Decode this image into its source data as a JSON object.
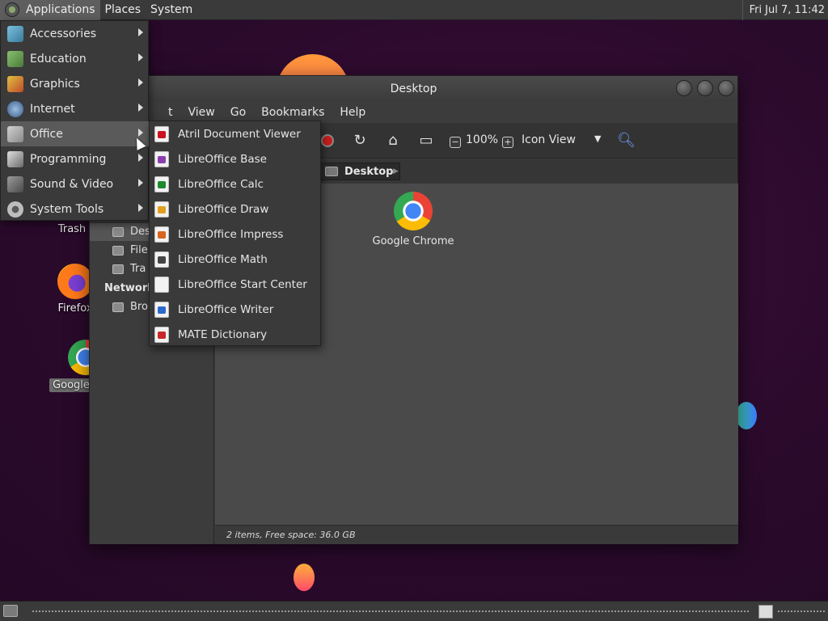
{
  "top_panel": {
    "menus": [
      "Applications",
      "Places",
      "System"
    ],
    "clock": "Fri Jul  7, 11:42"
  },
  "desktop_icons": {
    "trash": "Trash",
    "firefox": "Firefox",
    "chrome": "Google"
  },
  "apps_menu": {
    "items": [
      {
        "label": "Accessories",
        "icon": "accessories-icon"
      },
      {
        "label": "Education",
        "icon": "education-icon"
      },
      {
        "label": "Graphics",
        "icon": "graphics-icon"
      },
      {
        "label": "Internet",
        "icon": "internet-icon"
      },
      {
        "label": "Office",
        "icon": "office-icon"
      },
      {
        "label": "Programming",
        "icon": "programming-icon"
      },
      {
        "label": "Sound & Video",
        "icon": "sound-video-icon"
      },
      {
        "label": "System Tools",
        "icon": "system-tools-icon"
      }
    ],
    "active": "Office"
  },
  "office_submenu": {
    "items": [
      {
        "label": "Atril Document Viewer",
        "icon": "atril-icon"
      },
      {
        "label": "LibreOffice Base",
        "icon": "libreoffice-base-icon"
      },
      {
        "label": "LibreOffice Calc",
        "icon": "libreoffice-calc-icon"
      },
      {
        "label": "LibreOffice Draw",
        "icon": "libreoffice-draw-icon"
      },
      {
        "label": "LibreOffice Impress",
        "icon": "libreoffice-impress-icon"
      },
      {
        "label": "LibreOffice Math",
        "icon": "libreoffice-math-icon"
      },
      {
        "label": "LibreOffice Start Center",
        "icon": "libreoffice-start-center-icon"
      },
      {
        "label": "LibreOffice Writer",
        "icon": "libreoffice-writer-icon"
      },
      {
        "label": "MATE Dictionary",
        "icon": "dictionary-icon"
      }
    ],
    "colors": [
      "#c8141e",
      "#8a3fb0",
      "#1e8a2e",
      "#e0a020",
      "#d8641e",
      "#444444",
      "#ffffff",
      "#2a6ad0",
      "#c82828"
    ]
  },
  "window": {
    "title": "Desktop",
    "menubar": [
      "t",
      "View",
      "Go",
      "Bookmarks",
      "Help"
    ],
    "toolbar": {
      "zoom": "100%",
      "view_mode": "Icon View",
      "zoom_out_glyph": "−",
      "zoom_in_glyph": "+"
    },
    "location": "Desktop",
    "sidebar": {
      "items": [
        "Des",
        "File",
        "Tra"
      ],
      "network_heading": "Network",
      "network_items": [
        "Bro"
      ]
    },
    "content_items": [
      {
        "label": "Google Chrome",
        "icon": "google-chrome-icon"
      }
    ],
    "status": "2 items, Free space: 36.0 GB"
  }
}
